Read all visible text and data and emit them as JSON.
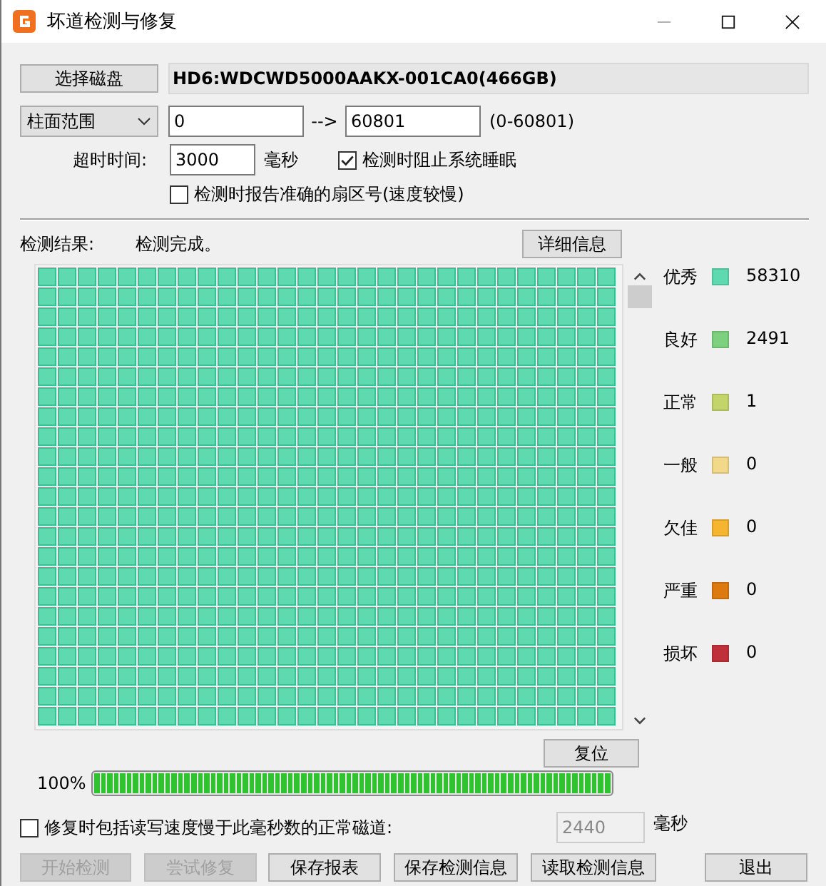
{
  "window": {
    "title": "坏道检测与修复"
  },
  "disk": {
    "button": "选择磁盘",
    "name": "HD6:WDCWD5000AAKX-001CA0(466GB)"
  },
  "range": {
    "mode": "柱面范围",
    "from": "0",
    "arrow": "-->",
    "to": "60801",
    "hint": "(0-60801)"
  },
  "timeout": {
    "label": "超时时间:",
    "value": "3000",
    "unit": "毫秒"
  },
  "options": [
    {
      "label": "检测时阻止系统睡眠",
      "checked": true
    },
    {
      "label": "检测时报告准确的扇区号(速度较慢)",
      "checked": false
    }
  ],
  "result": {
    "label": "检测结果:",
    "status": "检测完成。",
    "details_button": "详细信息"
  },
  "legend": [
    {
      "label": "优秀",
      "color": "#5fd9b0",
      "count": "58310"
    },
    {
      "label": "良好",
      "color": "#7dd07d",
      "count": "2491"
    },
    {
      "label": "正常",
      "color": "#c3d56a",
      "count": "1"
    },
    {
      "label": "一般",
      "color": "#f2d98a",
      "count": "0"
    },
    {
      "label": "欠佳",
      "color": "#f5b52e",
      "count": "0"
    },
    {
      "label": "严重",
      "color": "#dc7a10",
      "count": "0"
    },
    {
      "label": "损坏",
      "color": "#c0303a",
      "count": "0"
    }
  ],
  "reset_button": "复位",
  "progress": {
    "reading": "100%",
    "level": 1
  },
  "repair_option": {
    "label": "修复时包括读写速度慢于此毫秒数的正常磁道:",
    "checked": false,
    "value": "2440",
    "unit": "毫秒",
    "disabled": true
  },
  "buttons": [
    {
      "label": "开始检测",
      "disabled": true
    },
    {
      "label": "尝试修复",
      "disabled": true
    },
    {
      "label": "保存报表",
      "disabled": false
    },
    {
      "label": "保存检测信息",
      "disabled": false
    },
    {
      "label": "读取检测信息",
      "disabled": false
    },
    {
      "label": "退出",
      "disabled": false
    }
  ]
}
